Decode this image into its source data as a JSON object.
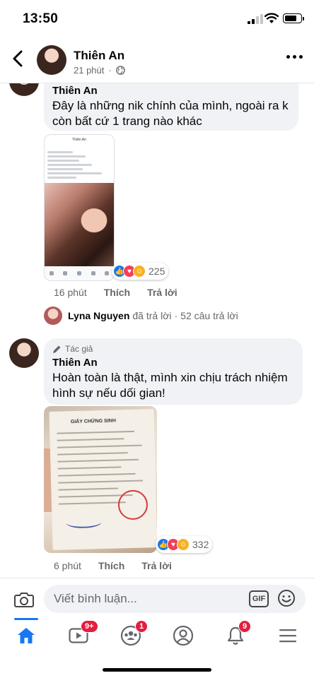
{
  "status_bar": {
    "time": "13:50",
    "battery_level": 0.8
  },
  "header": {
    "name": "Thiên An",
    "time": "21 phút"
  },
  "comments": [
    {
      "author": "Thiên An",
      "text": "Đây là những nik chính của mình, ngoài ra k còn bất cứ 1 trang nào khác",
      "mini_header": "Thiên An",
      "reactions_count": "225",
      "time": "16 phút",
      "like_label": "Thích",
      "reply_label": "Trả lời"
    },
    {
      "author_tag": "Tác giả",
      "author": "Thiên An",
      "text": "Hoàn toàn là thật, mình xin chịu trách nhiệm hình sự nếu dối gian!",
      "document_title": "GIẤY CHỨNG SINH",
      "reactions_count": "332",
      "time": "6 phút",
      "like_label": "Thích",
      "reply_label": "Trả lời"
    }
  ],
  "replies": {
    "name": "Lyna Nguyen",
    "action": "đã trả lời",
    "separator": "·",
    "count_text": "52 câu trả lời"
  },
  "input": {
    "placeholder": "Viết bình luận...",
    "gif_label": "GIF"
  },
  "bottom_nav": {
    "items": [
      {
        "name": "home-icon",
        "badge": ""
      },
      {
        "name": "video-icon",
        "badge": "9+"
      },
      {
        "name": "groups-icon",
        "badge": "1"
      },
      {
        "name": "profile-icon",
        "badge": ""
      },
      {
        "name": "bell-icon",
        "badge": "9"
      },
      {
        "name": "menu-icon",
        "badge": ""
      }
    ]
  },
  "colors": {
    "accent": "#1877f2",
    "badge": "#e41e3f",
    "bubble": "#f0f2f5",
    "secondary_text": "#65676b"
  }
}
